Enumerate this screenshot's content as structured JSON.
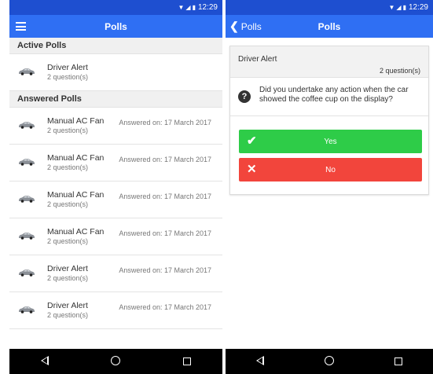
{
  "status": {
    "time": "12:29",
    "icons": [
      "wifi-icon",
      "signal-icon",
      "battery-icon"
    ]
  },
  "left": {
    "title": "Polls",
    "active_header": "Active Polls",
    "answered_header": "Answered Polls",
    "active_polls": [
      {
        "name": "Driver Alert",
        "questions": "2 question(s)"
      }
    ],
    "answered_polls": [
      {
        "name": "Manual AC Fan",
        "questions": "2 question(s)",
        "answered": "Answered on: 17 March 2017"
      },
      {
        "name": "Manual AC Fan",
        "questions": "2 question(s)",
        "answered": "Answered on: 17 March 2017"
      },
      {
        "name": "Manual AC Fan",
        "questions": "2 question(s)",
        "answered": "Answered on: 17 March 2017"
      },
      {
        "name": "Manual AC Fan",
        "questions": "2 question(s)",
        "answered": "Answered on: 17 March 2017"
      },
      {
        "name": "Driver Alert",
        "questions": "2 question(s)",
        "answered": "Answered on: 17 March 2017"
      },
      {
        "name": "Driver Alert",
        "questions": "2 question(s)",
        "answered": "Answered on: 17 March 2017"
      }
    ]
  },
  "right": {
    "back_label": "Polls",
    "title": "Polls",
    "poll_title": "Driver Alert",
    "poll_count": "2 question(s)",
    "question": "Did you undertake any action when the car showed the coffee cup on the display?",
    "yes_label": "Yes",
    "no_label": "No"
  },
  "colors": {
    "appbar": "#2f6ff3",
    "statusbar": "#1e4fd0",
    "yes": "#2ecc48",
    "no": "#f2453c"
  },
  "nav_icons": [
    "back-triangle-icon",
    "home-circle-icon",
    "recents-square-icon"
  ]
}
